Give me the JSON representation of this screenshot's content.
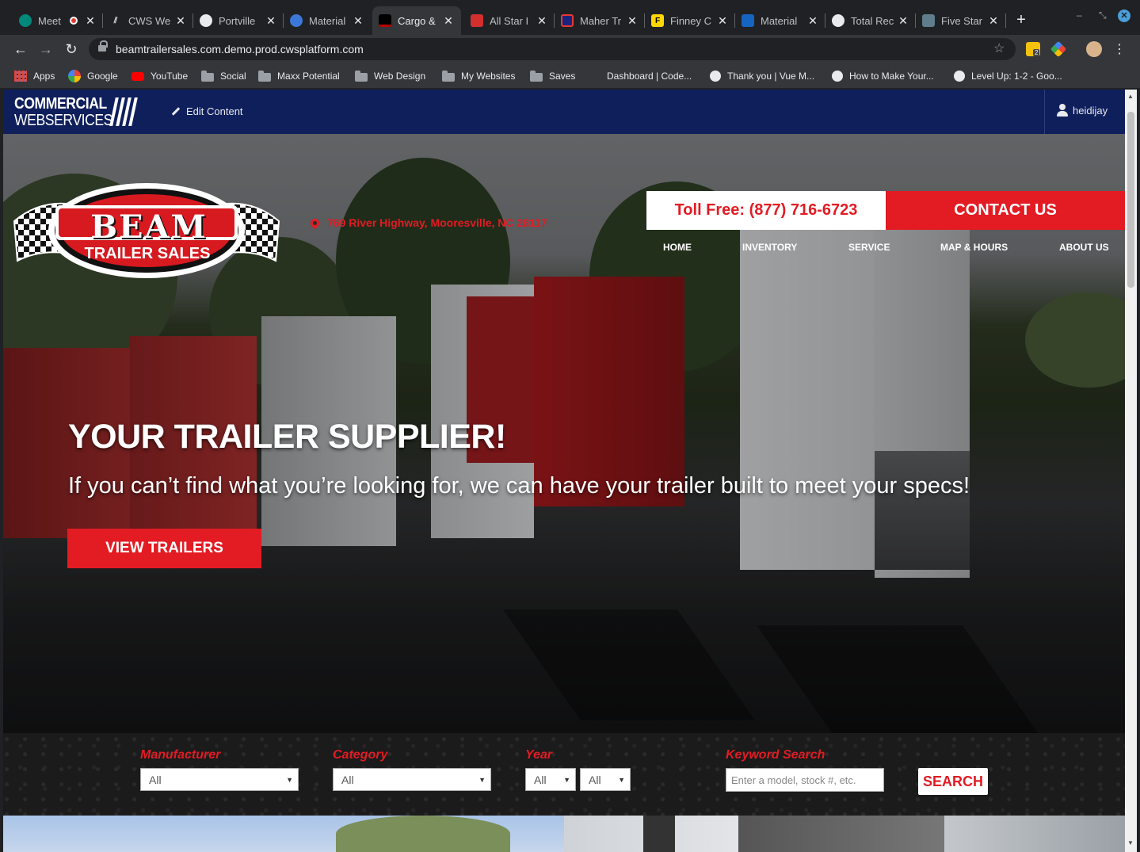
{
  "browser": {
    "tabs": [
      {
        "title": "Meet",
        "fav_color": "#00897b",
        "fav_text": ""
      },
      {
        "title": "CWS We",
        "fav_color": "#5f6368",
        "fav_text": "\\\\"
      },
      {
        "title": "Portville",
        "fav_color": "#e8eaed",
        "fav_text": ""
      },
      {
        "title": "Material",
        "fav_color": "#3c78d8",
        "fav_text": ""
      },
      {
        "title": "Cargo &",
        "fav_color": "#b00",
        "fav_text": ""
      },
      {
        "title": "All Star I",
        "fav_color": "#d32f2f",
        "fav_text": ""
      },
      {
        "title": "Maher Tr",
        "fav_color": "#1a237e",
        "fav_text": ""
      },
      {
        "title": "Finney C",
        "fav_color": "#ffd600",
        "fav_text": "F"
      },
      {
        "title": "Material",
        "fav_color": "#1565c0",
        "fav_text": ""
      },
      {
        "title": "Total Rec",
        "fav_color": "#e8eaed",
        "fav_text": ""
      },
      {
        "title": "Five Star",
        "fav_color": "#607d8b",
        "fav_text": ""
      }
    ],
    "new_tab": "+",
    "url": "beamtrailersales.com.demo.prod.cwsplatform.com",
    "bookmarks": [
      {
        "label": "Apps",
        "icon": "apps-icon"
      },
      {
        "label": "Google",
        "icon": "google-icon"
      },
      {
        "label": "YouTube",
        "icon": "youtube-icon"
      },
      {
        "label": "Social",
        "icon": "folder-icon"
      },
      {
        "label": "Maxx Potential",
        "icon": "folder-icon"
      },
      {
        "label": "Web Design",
        "icon": "folder-icon"
      },
      {
        "label": "My Websites",
        "icon": "folder-icon"
      },
      {
        "label": "Saves",
        "icon": "folder-icon"
      },
      {
        "label": "Dashboard | Code...",
        "icon": "codepen-icon"
      },
      {
        "label": "Thank you | Vue M...",
        "icon": "globe-icon"
      },
      {
        "label": "How to Make Your...",
        "icon": "globe-icon"
      },
      {
        "label": "Level Up: 1-2 - Goo...",
        "icon": "globe-icon"
      }
    ],
    "ext_badge": "2"
  },
  "cms": {
    "logo_line1": "COMMERCIAL",
    "logo_line2": "WEBSERVICES",
    "edit_label": "Edit Content",
    "username": "heidijay"
  },
  "site": {
    "logo_word": "BEAM",
    "logo_sub": "TRAILER SALES",
    "address": "769 River Highway, Mooresville, NC 28117",
    "toll_free": "Toll Free: (877) 716-6723",
    "contact_label": "CONTACT US",
    "nav": [
      "HOME",
      "INVENTORY",
      "SERVICE",
      "MAP & HOURS",
      "ABOUT US"
    ],
    "headline": "YOUR TRAILER SUPPLIER!",
    "subline": "If you can’t find what you’re looking for, we can have your trailer built to meet your specs!",
    "cta_label": "VIEW TRAILERS",
    "brand_red": "#e31b23",
    "brand_navy": "#0f1f5c"
  },
  "search": {
    "manufacturer_label": "Manufacturer",
    "manufacturer_value": "All",
    "category_label": "Category",
    "category_value": "All",
    "year_label": "Year",
    "year_from_value": "All",
    "year_to_value": "All",
    "keyword_label": "Keyword Search",
    "keyword_placeholder": "Enter a model, stock #, etc.",
    "button_label": "SEARCH"
  }
}
